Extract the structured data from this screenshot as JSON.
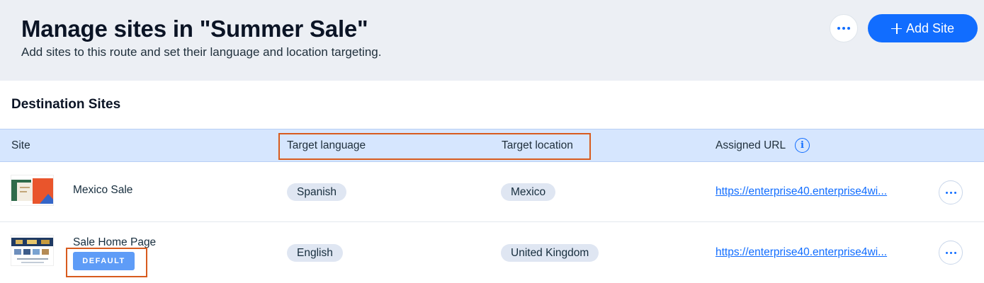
{
  "header": {
    "title": "Manage sites in \"Summer Sale\"",
    "subtitle": "Add sites to this route and set their language and location targeting.",
    "more_icon": "more-dots-icon",
    "add_button_label": "Add Site",
    "add_icon": "plus-icon"
  },
  "section": {
    "title": "Destination Sites"
  },
  "table": {
    "columns": {
      "site": "Site",
      "language": "Target language",
      "location": "Target location",
      "url": "Assigned URL"
    },
    "info_icon": "info-icon",
    "rows": [
      {
        "name": "Mexico Sale",
        "language": "Spanish",
        "location": "Mexico",
        "url": "https://enterprise40.enterprise4wi..."
      },
      {
        "name": "Sale Home Page",
        "badge": "DEFAULT",
        "language": "English",
        "location": "United Kingdom",
        "url": "https://enterprise40.enterprise4wi..."
      }
    ]
  },
  "colors": {
    "accent": "#116dff",
    "header_bg": "#eceff4",
    "table_head_bg": "#d6e6fe",
    "highlight": "#d85b1e",
    "badge_bg": "#5e9cf7"
  }
}
